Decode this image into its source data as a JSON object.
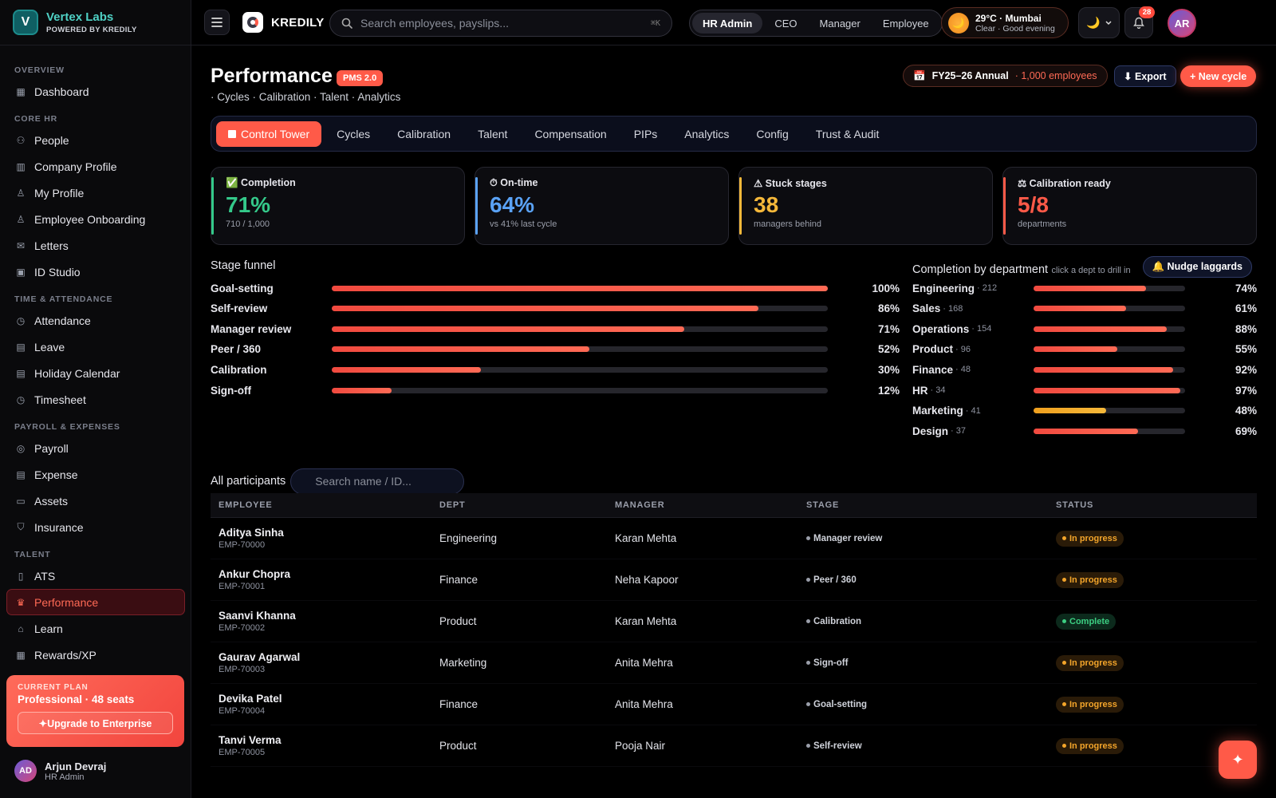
{
  "brand": {
    "name": "Vertex Labs",
    "sub": "POWERED BY KREDILY",
    "logo": "V"
  },
  "sidebar": {
    "sections": [
      {
        "title": "OVERVIEW",
        "items": [
          {
            "label": "Dashboard",
            "icon": "grid-icon"
          }
        ]
      },
      {
        "title": "CORE HR",
        "items": [
          {
            "label": "People",
            "icon": "people-icon"
          },
          {
            "label": "Company Profile",
            "icon": "building-icon"
          },
          {
            "label": "My Profile",
            "icon": "user-icon"
          },
          {
            "label": "Employee Onboarding",
            "icon": "user-plus-icon"
          },
          {
            "label": "Letters",
            "icon": "mail-icon"
          },
          {
            "label": "ID Studio",
            "icon": "id-card-icon"
          }
        ]
      },
      {
        "title": "TIME & ATTENDANCE",
        "items": [
          {
            "label": "Attendance",
            "icon": "clock-icon"
          },
          {
            "label": "Leave",
            "icon": "calendar-icon"
          },
          {
            "label": "Holiday Calendar",
            "icon": "calendar-icon"
          },
          {
            "label": "Timesheet",
            "icon": "clock-icon"
          }
        ]
      },
      {
        "title": "PAYROLL & EXPENSES",
        "items": [
          {
            "label": "Payroll",
            "icon": "coin-icon"
          },
          {
            "label": "Expense",
            "icon": "receipt-icon"
          },
          {
            "label": "Assets",
            "icon": "monitor-icon"
          },
          {
            "label": "Insurance",
            "icon": "shield-icon"
          }
        ]
      },
      {
        "title": "TALENT",
        "items": [
          {
            "label": "ATS",
            "icon": "clipboard-icon"
          },
          {
            "label": "Performance",
            "icon": "trophy-icon",
            "active": true
          },
          {
            "label": "Learn",
            "icon": "graduation-cap-icon"
          },
          {
            "label": "Rewards/XP",
            "icon": "gift-icon"
          }
        ]
      }
    ],
    "plan": {
      "kicker": "CURRENT PLAN",
      "value": "Professional · 48 seats",
      "button": "✦Upgrade to Enterprise"
    },
    "user": {
      "initials": "AD",
      "name": "Arjun Devraj",
      "role": "HR Admin"
    }
  },
  "topbar": {
    "app_name": "KREDILY",
    "search_placeholder": "Search employees, payslips...",
    "search_shortcut": "⌘K",
    "roles": [
      "HR Admin",
      "CEO",
      "Manager",
      "Employee"
    ],
    "active_role": "HR Admin",
    "weather": {
      "line1": "29°C · Mumbai",
      "line2": "Clear · Good evening"
    },
    "notifications": "28",
    "avatar": "AR"
  },
  "page": {
    "title": "Performance",
    "badge": "PMS 2.0",
    "subtitle": "· Cycles · Calibration · Talent · Analytics",
    "cycle": "FY25–26 Annual",
    "cycle_count": "· 1,000 employees",
    "export": "⬇ Export",
    "new_cycle": "+ New cycle",
    "tabs": [
      "Control Tower",
      "Cycles",
      "Calibration",
      "Talent",
      "Compensation",
      "PIPs",
      "Analytics",
      "Config",
      "Trust & Audit"
    ]
  },
  "kpis": [
    {
      "label": "✅ Completion",
      "value": "71%",
      "sub": "710 / 1,000",
      "color": "#34c98a"
    },
    {
      "label": "⏱ On-time",
      "value": "64%",
      "sub": "vs 41% last cycle",
      "color": "#5aa2f5"
    },
    {
      "label": "⚠ Stuck stages",
      "value": "38",
      "sub": "managers behind",
      "color": "#f5b83a"
    },
    {
      "label": "⚖ Calibration ready",
      "value": "5/8",
      "sub": "departments",
      "color": "#ff5a48"
    }
  ],
  "funnel": {
    "title": "Stage funnel",
    "rows": [
      {
        "label": "Goal-setting",
        "pct": 100,
        "text": "100%"
      },
      {
        "label": "Self-review",
        "pct": 86,
        "text": "86%"
      },
      {
        "label": "Manager review",
        "pct": 71,
        "text": "71%"
      },
      {
        "label": "Peer / 360",
        "pct": 52,
        "text": "52%"
      },
      {
        "label": "Calibration",
        "pct": 30,
        "text": "30%"
      },
      {
        "label": "Sign-off",
        "pct": 12,
        "text": "12%"
      }
    ]
  },
  "departments": {
    "title": "Completion by department",
    "hint": "click a dept to drill in",
    "nudge": "🔔 Nudge laggards",
    "rows": [
      {
        "name": "Engineering",
        "count": "· 212",
        "pct": 74,
        "text": "74%"
      },
      {
        "name": "Sales",
        "count": "· 168",
        "pct": 61,
        "text": "61%"
      },
      {
        "name": "Operations",
        "count": "· 154",
        "pct": 88,
        "text": "88%"
      },
      {
        "name": "Product",
        "count": "· 96",
        "pct": 55,
        "text": "55%"
      },
      {
        "name": "Finance",
        "count": "· 48",
        "pct": 92,
        "text": "92%"
      },
      {
        "name": "HR",
        "count": "· 34",
        "pct": 97,
        "text": "97%"
      },
      {
        "name": "Marketing",
        "count": "· 41",
        "pct": 48,
        "text": "48%",
        "warn": true
      },
      {
        "name": "Design",
        "count": "· 37",
        "pct": 69,
        "text": "69%"
      }
    ]
  },
  "participants": {
    "title": "All participants",
    "search_placeholder": "Search name / ID...",
    "columns": [
      "EMPLOYEE",
      "DEPT",
      "MANAGER",
      "STAGE",
      "STATUS"
    ],
    "rows": [
      {
        "name": "Aditya Sinha",
        "id": "EMP-70000",
        "dept": "Engineering",
        "manager": "Karan Mehta",
        "stage": "Manager review",
        "status": "In progress"
      },
      {
        "name": "Ankur Chopra",
        "id": "EMP-70001",
        "dept": "Finance",
        "manager": "Neha Kapoor",
        "stage": "Peer / 360",
        "status": "In progress"
      },
      {
        "name": "Saanvi Khanna",
        "id": "EMP-70002",
        "dept": "Product",
        "manager": "Karan Mehta",
        "stage": "Calibration",
        "status": "Complete"
      },
      {
        "name": "Gaurav Agarwal",
        "id": "EMP-70003",
        "dept": "Marketing",
        "manager": "Anita Mehra",
        "stage": "Sign-off",
        "status": "In progress"
      },
      {
        "name": "Devika Patel",
        "id": "EMP-70004",
        "dept": "Finance",
        "manager": "Anita Mehra",
        "stage": "Goal-setting",
        "status": "In progress"
      },
      {
        "name": "Tanvi Verma",
        "id": "EMP-70005",
        "dept": "Product",
        "manager": "Pooja Nair",
        "stage": "Self-review",
        "status": "In progress"
      }
    ]
  }
}
